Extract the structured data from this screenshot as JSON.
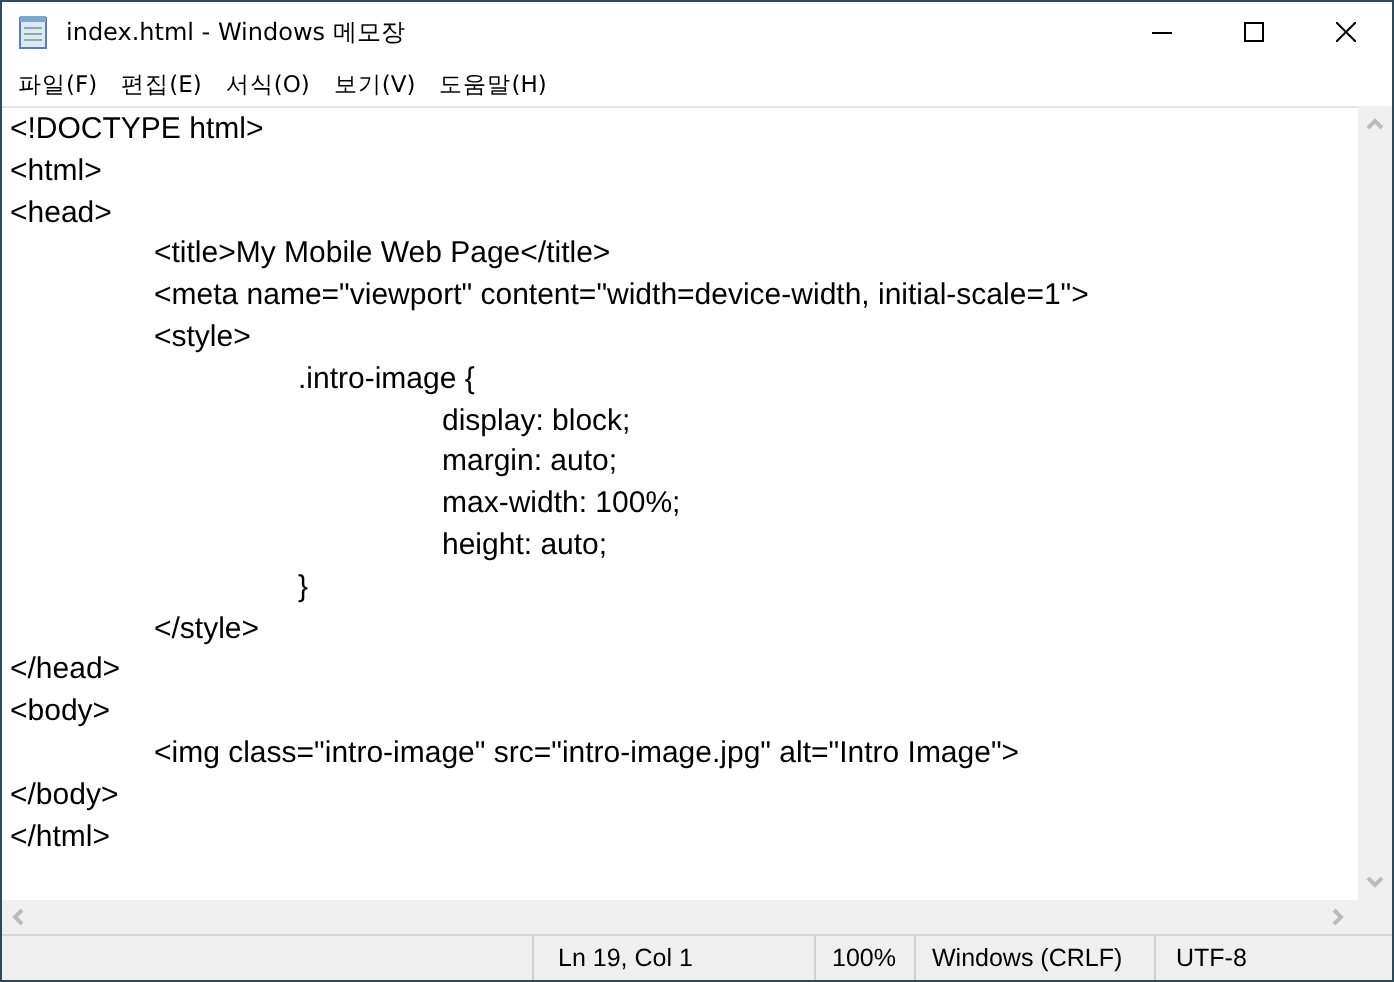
{
  "window": {
    "title": "index.html - Windows 메모장"
  },
  "menu": [
    "파일(F)",
    "편집(E)",
    "서식(O)",
    "보기(V)",
    "도움말(H)"
  ],
  "editor": {
    "lines": [
      "<!DOCTYPE html>",
      "<html>",
      "<head>",
      "\t<title>My Mobile Web Page</title>",
      "\t<meta name=\"viewport\" content=\"width=device-width, initial-scale=1\">",
      "\t<style>",
      "\t\t.intro-image {",
      "\t\t\tdisplay: block;",
      "\t\t\tmargin: auto;",
      "\t\t\tmax-width: 100%;",
      "\t\t\theight: auto;",
      "\t\t}",
      "\t</style>",
      "</head>",
      "<body>",
      "\t<img class=\"intro-image\" src=\"intro-image.jpg\" alt=\"Intro Image\">",
      "</body>",
      "</html>"
    ]
  },
  "status_bar": {
    "position": "Ln 19, Col 1",
    "zoom": "100%",
    "line_ending": "Windows (CRLF)",
    "encoding": "UTF-8"
  }
}
